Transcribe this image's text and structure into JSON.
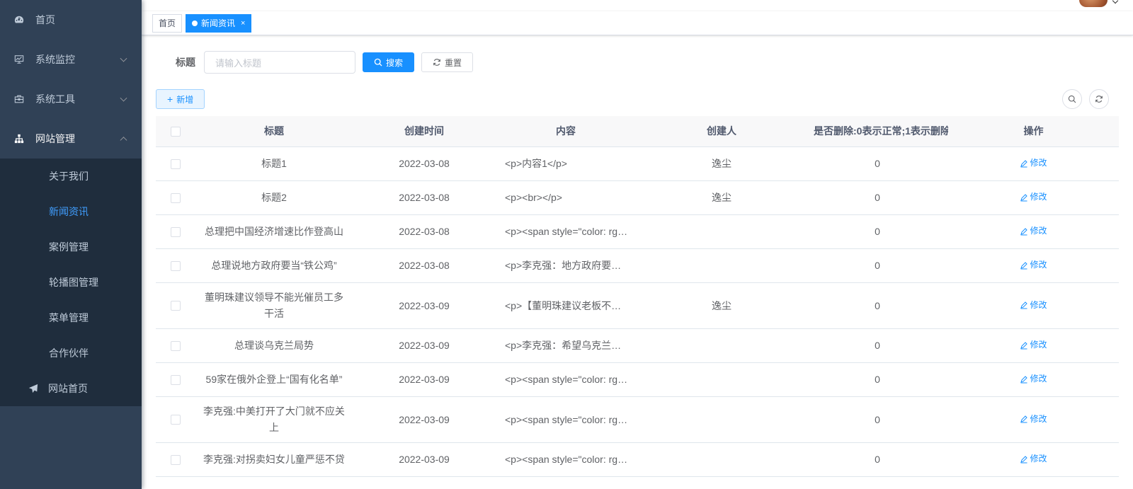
{
  "sidebar": {
    "items": [
      {
        "label": "首页",
        "icon": "dashboard-icon"
      },
      {
        "label": "系统监控",
        "icon": "monitor-icon"
      },
      {
        "label": "系统工具",
        "icon": "toolbox-icon"
      },
      {
        "label": "网站管理",
        "icon": "tree-icon"
      }
    ],
    "submenu": [
      {
        "label": "关于我们"
      },
      {
        "label": "新闻资讯"
      },
      {
        "label": "案例管理"
      },
      {
        "label": "轮播图管理"
      },
      {
        "label": "菜单管理"
      },
      {
        "label": "合作伙伴"
      },
      {
        "label": "网站首页",
        "icon": "send-icon"
      }
    ]
  },
  "tags": {
    "home": "首页",
    "active": "新闻资讯",
    "close": "×"
  },
  "search": {
    "label": "标题",
    "placeholder": "请输入标题",
    "search_btn": "搜索",
    "reset_btn": "重置"
  },
  "toolbar": {
    "add_btn": "新增"
  },
  "table": {
    "headers": {
      "title": "标题",
      "time": "创建时间",
      "content": "内容",
      "creator": "创建人",
      "deleted": "是否删除:0表示正常;1表示删除",
      "op": "操作"
    },
    "edit_label": "修改",
    "rows": [
      {
        "title": "标题1",
        "time": "2022-03-08",
        "content": "<p>内容1</p>",
        "creator": "逸尘",
        "deleted": "0"
      },
      {
        "title": "标题2",
        "time": "2022-03-08",
        "content": "<p><br></p>",
        "creator": "逸尘",
        "deleted": "0"
      },
      {
        "title": "总理把中国经济增速比作登高山",
        "time": "2022-03-08",
        "content": "<p><span style=\"color: rgb(51…",
        "creator": "",
        "deleted": "0"
      },
      {
        "title": "总理说地方政府要当“铁公鸡”",
        "time": "2022-03-08",
        "content": "<p>李克强：地方政府要当铁…",
        "creator": "",
        "deleted": "0"
      },
      {
        "title": "董明珠建议领导不能光催员工多干活",
        "time": "2022-03-09",
        "content": "<p>【董明珠建议老板不能光…",
        "creator": "逸尘",
        "deleted": "0"
      },
      {
        "title": "总理谈乌克兰局势",
        "time": "2022-03-09",
        "content": "<p>李克强：希望乌克兰局势…",
        "creator": "",
        "deleted": "0"
      },
      {
        "title": "59家在俄外企登上“国有化名单”",
        "time": "2022-03-09",
        "content": "<p><span style=\"color: rgb(51…",
        "creator": "",
        "deleted": "0"
      },
      {
        "title": "李克强:中美打开了大门就不应关上",
        "time": "2022-03-09",
        "content": "<p><span style=\"color: rgb(51…",
        "creator": "",
        "deleted": "0"
      },
      {
        "title": "李克强:对拐卖妇女儿童严惩不贷",
        "time": "2022-03-09",
        "content": "<p><span style=\"color: rgb(51…",
        "creator": "",
        "deleted": "0"
      }
    ]
  }
}
